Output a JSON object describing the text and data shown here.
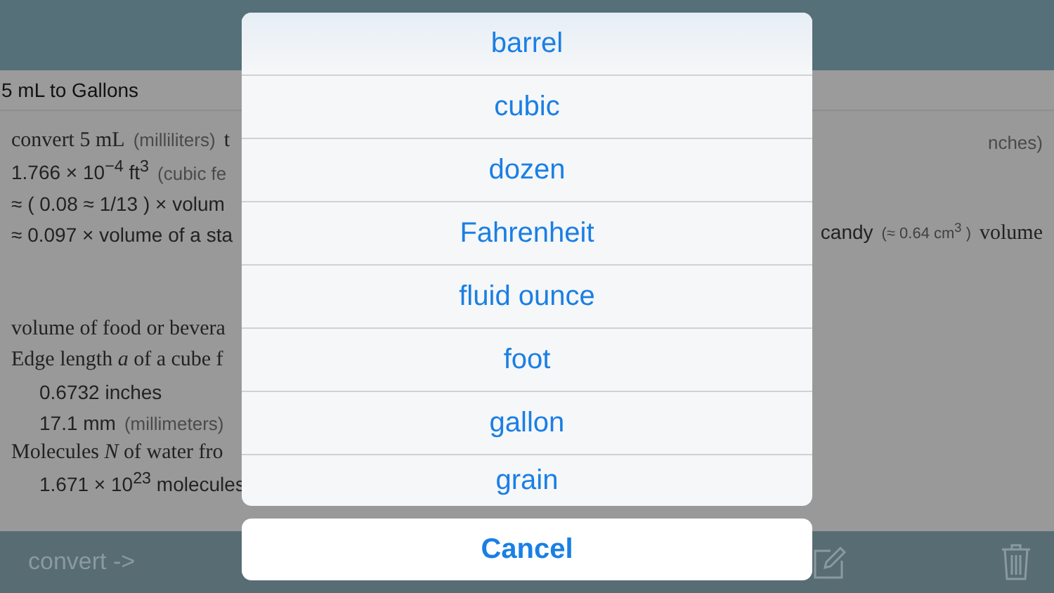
{
  "header": {
    "title": "5 mL to Gallons"
  },
  "results": [
    {
      "left": [
        {
          "text": "convert 5 mL",
          "kind": "serif"
        },
        {
          "text": "(milliliters)",
          "kind": "muted"
        },
        {
          "text": "t",
          "kind": "serif"
        }
      ],
      "right": [
        {
          "text": "nches)",
          "kind": "muted"
        }
      ]
    },
    {
      "left": [
        {
          "text": "1.766 × 10$^{−4}$ ft$^{3}$",
          "kind": "sans"
        },
        {
          "text": "(cubic fe",
          "kind": "muted"
        }
      ]
    },
    {
      "left": [
        {
          "text": "≈ ( 0.08 ≈ 1/13 ) × volum",
          "kind": "sans"
        }
      ]
    },
    {
      "left": [
        {
          "text": "≈ 0.097 × volume of a sta",
          "kind": "sans"
        }
      ],
      "right": [
        {
          "text": "candy",
          "kind": "sans"
        },
        {
          "text": "(≈ 0.64 cm$^{3}$ )",
          "kind": "small"
        },
        {
          "text": "volume",
          "kind": "serif"
        }
      ]
    }
  ],
  "details": [
    {
      "left": [
        {
          "text": "volume of food or bevera",
          "kind": "serif"
        }
      ]
    },
    {
      "left": [
        {
          "text": "Edge length *a* of a cube f",
          "kind": "serif"
        }
      ],
      "children": [
        {
          "left": [
            {
              "text": "0.6732 inches",
              "kind": "sans"
            }
          ]
        },
        {
          "left": [
            {
              "text": "17.1 mm",
              "kind": "sans"
            },
            {
              "text": "(millimeters)",
              "kind": "muted"
            }
          ]
        }
      ]
    },
    {
      "left": [
        {
          "text": "Molecules *N* of water fro",
          "kind": "serif"
        }
      ],
      "children": [
        {
          "left": [
            {
              "text": "1.671 × 10$^{23}$ molecules",
              "kind": "sans"
            }
          ]
        }
      ]
    }
  ],
  "toolbar": {
    "label": "convert ->"
  },
  "sheet": {
    "options": [
      "barrel",
      "cubic",
      "dozen",
      "Fahrenheit",
      "fluid ounce",
      "foot",
      "gallon",
      "grain"
    ],
    "cancel": "Cancel"
  }
}
